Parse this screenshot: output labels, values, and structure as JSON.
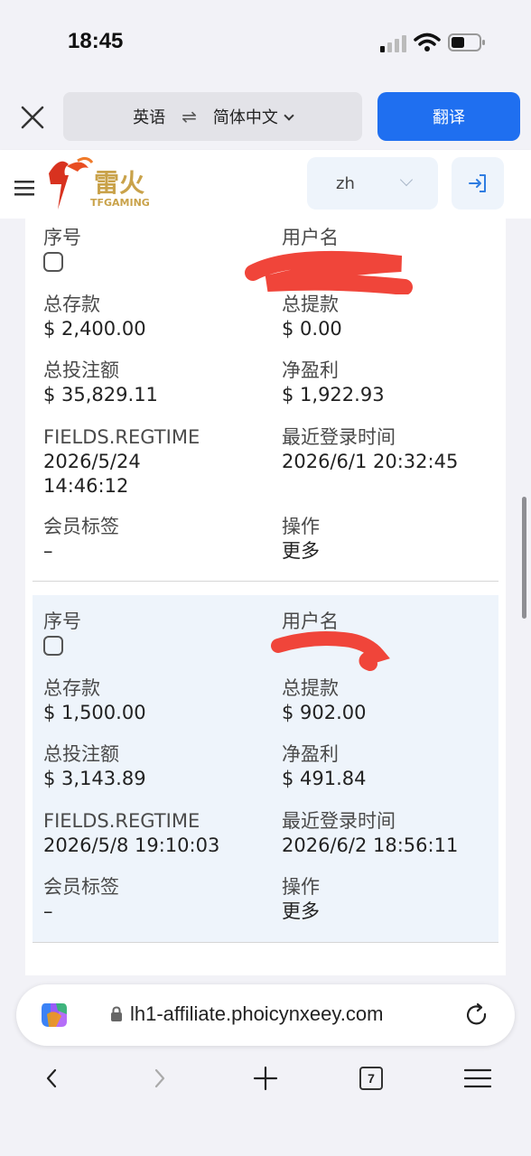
{
  "status_bar": {
    "time": "18:45"
  },
  "translate_bar": {
    "source_lang": "英语",
    "swap_symbol": "⇌",
    "target_lang": "简体中文",
    "translate_label": "翻译"
  },
  "site_header": {
    "logo_cn": "雷火",
    "logo_en": "TFGAMING",
    "language": "zh"
  },
  "records": [
    {
      "labels": {
        "index": "序号",
        "username": "用户名",
        "total_deposit": "总存款",
        "total_withdraw": "总提款",
        "total_bet": "总投注额",
        "net_profit": "净盈利",
        "regtime": "FIELDS.REGTIME",
        "last_login": "最近登录时间",
        "member_tag": "会员标签",
        "action": "操作"
      },
      "total_deposit": "$ 2,400.00",
      "total_withdraw": "$ 0.00",
      "total_bet": "$ 35,829.11",
      "net_profit": "$ 1,922.93",
      "regtime_date": "2026/5/24",
      "regtime_time": "14:46:12",
      "last_login": "2026/6/1 20:32:45",
      "member_tag": "–",
      "action": "更多"
    },
    {
      "labels": {
        "index": "序号",
        "username": "用户名",
        "total_deposit": "总存款",
        "total_withdraw": "总提款",
        "total_bet": "总投注额",
        "net_profit": "净盈利",
        "regtime": "FIELDS.REGTIME",
        "last_login": "最近登录时间",
        "member_tag": "会员标签",
        "action": "操作"
      },
      "total_deposit": "$ 1,500.00",
      "total_withdraw": "$ 902.00",
      "total_bet": "$ 3,143.89",
      "net_profit": "$ 491.84",
      "regtime": "2026/5/8 19:10:03",
      "last_login": "2026/6/2 18:56:11",
      "member_tag": "–",
      "action": "更多"
    }
  ],
  "browser": {
    "url": "lh1-affiliate.phoicynxeey.com",
    "tab_count": "7"
  },
  "colors": {
    "accent": "#1f6ff0",
    "redaction": "#f0453a",
    "alt_row": "#eef4fb"
  }
}
